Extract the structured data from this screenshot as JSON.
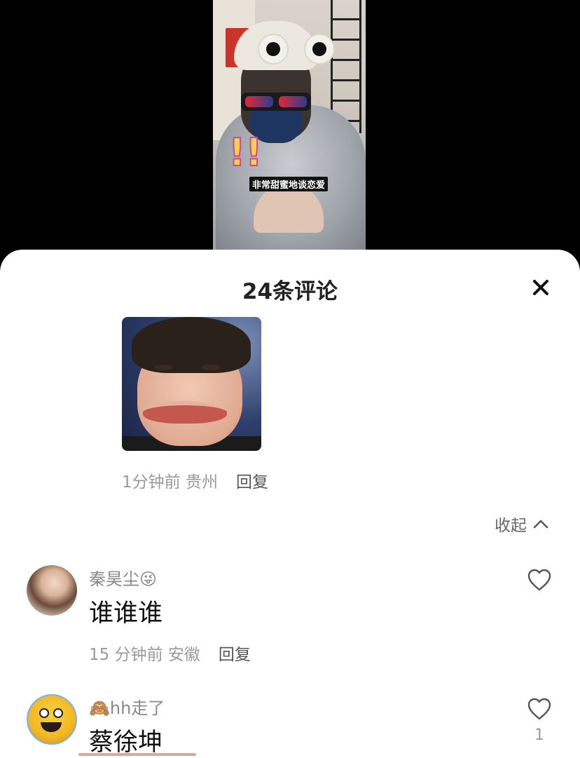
{
  "video": {
    "caption": "非常甜蜜地谈恋爱",
    "exclaim": "!!"
  },
  "sheet": {
    "title": "24条评论",
    "close_icon": "close-icon"
  },
  "sticker_reply": {
    "time_location": "1分钟前 贵州",
    "reply_label": "回复"
  },
  "collapse": {
    "label": "收起",
    "icon": "chevron-up-icon"
  },
  "comments": [
    {
      "username": "秦昊尘😜",
      "text": "谁谁谁",
      "time_location": "15 分钟前 安徽",
      "reply_label": "回复",
      "like_icon": "heart-outline-icon"
    },
    {
      "username": "🙈hh走了",
      "text": "蔡徐坤",
      "like_icon": "heart-outline-icon",
      "like_count": "1"
    }
  ],
  "colors": {
    "background": "#000000",
    "sheet": "#ffffff",
    "underline": "#d9a79b",
    "muted_text": "#999999"
  }
}
